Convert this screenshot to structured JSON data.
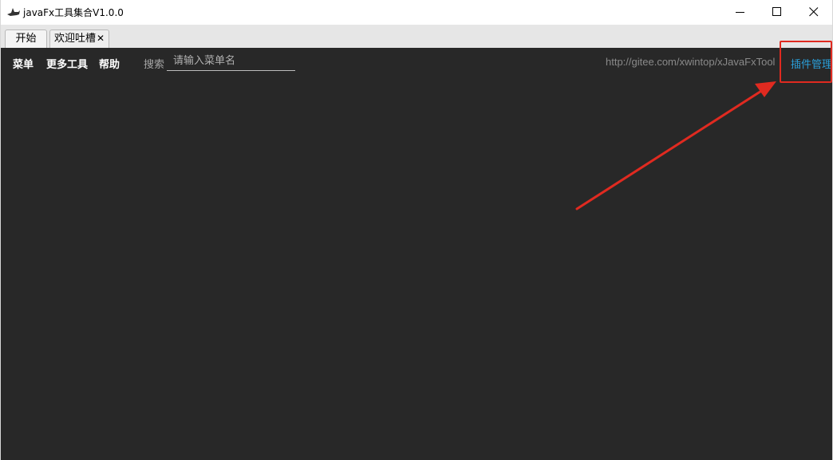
{
  "window": {
    "title": "javaFx工具集合V1.0.0"
  },
  "tabs": [
    {
      "label": "开始"
    },
    {
      "label": "欢迎吐槽",
      "close": "✕"
    }
  ],
  "menubar": {
    "items": [
      {
        "label": "菜单"
      },
      {
        "label": "更多工具"
      },
      {
        "label": "帮助"
      }
    ],
    "search_label": "搜索",
    "search_placeholder": "请输入菜单名",
    "search_value": "",
    "repo_url": "http://gitee.com/xwintop/xJavaFxTool",
    "plugin_manage_label": "插件管理"
  },
  "colors": {
    "content_bg": "#282828",
    "link_accent": "#2a9ed8",
    "annotation": "#e02a20"
  },
  "icons": {
    "app": "shark-icon",
    "minimize": "minimize-icon",
    "maximize": "maximize-icon",
    "close": "close-icon"
  }
}
